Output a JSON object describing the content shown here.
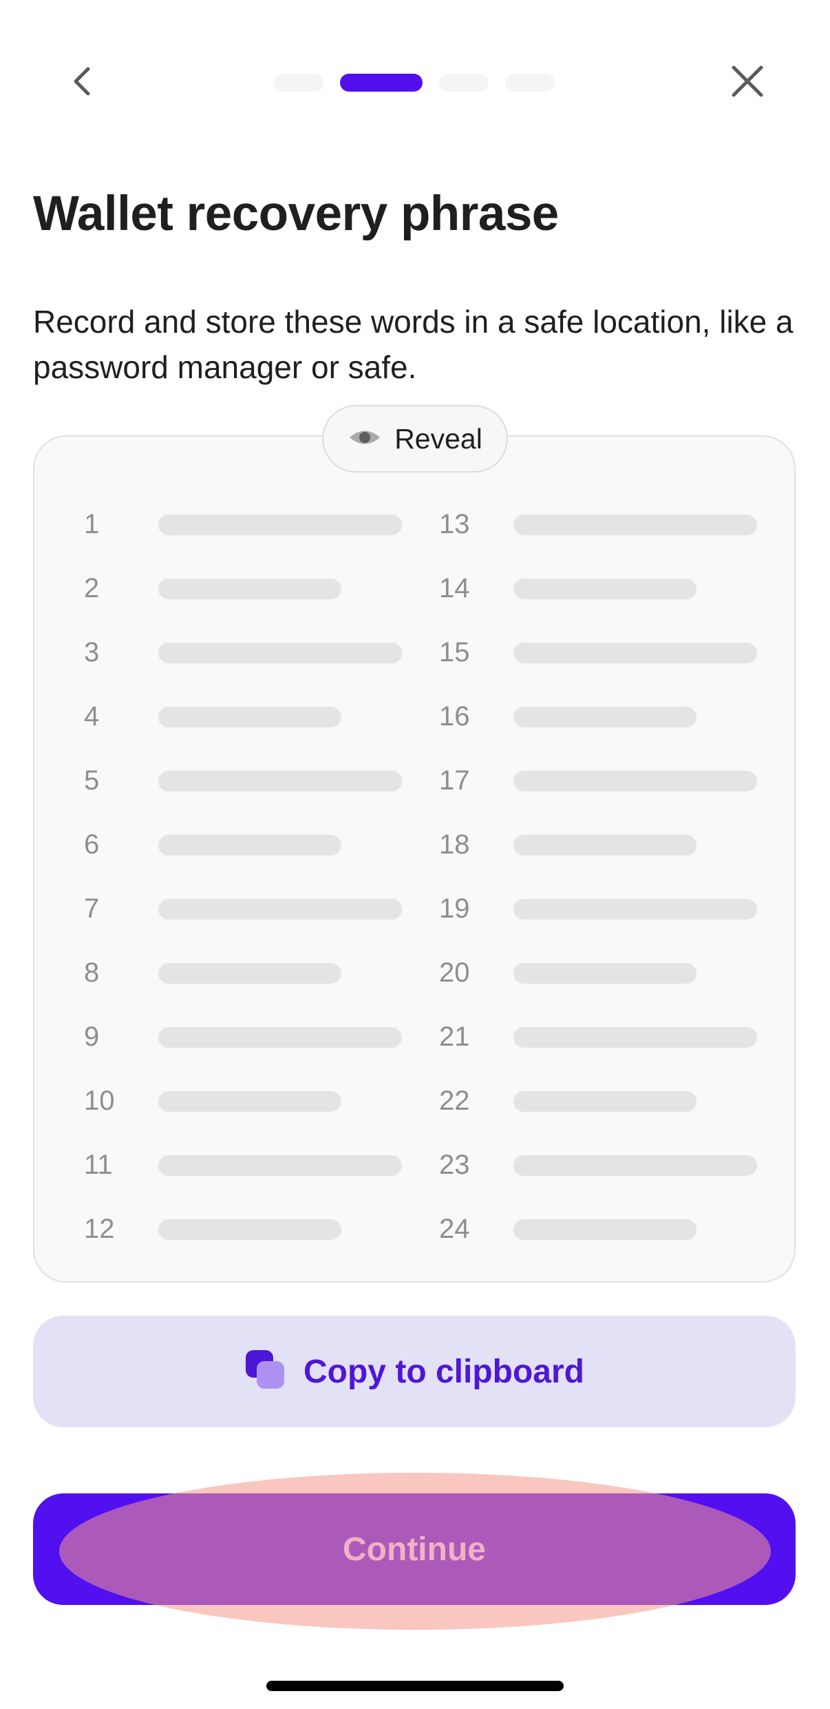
{
  "nav": {
    "back_icon": "chevron-left-icon",
    "close_icon": "close-icon",
    "steps": {
      "total": 4,
      "current": 2
    }
  },
  "page": {
    "title": "Wallet recovery phrase",
    "description": "Record and store these words in a safe location, like a password manager or safe."
  },
  "phrase": {
    "reveal_label": "Reveal",
    "reveal_icon": "eye-icon",
    "hidden": true,
    "left_column": [
      "1",
      "2",
      "3",
      "4",
      "5",
      "6",
      "7",
      "8",
      "9",
      "10",
      "11",
      "12"
    ],
    "right_column": [
      "13",
      "14",
      "15",
      "16",
      "17",
      "18",
      "19",
      "20",
      "21",
      "22",
      "23",
      "24"
    ]
  },
  "actions": {
    "copy_label": "Copy to clipboard",
    "copy_icon": "copy-icon",
    "continue_label": "Continue"
  },
  "colors": {
    "accent": "#5210f0",
    "copy_bg": "#e3e1f5",
    "copy_text": "#4e17d6"
  }
}
